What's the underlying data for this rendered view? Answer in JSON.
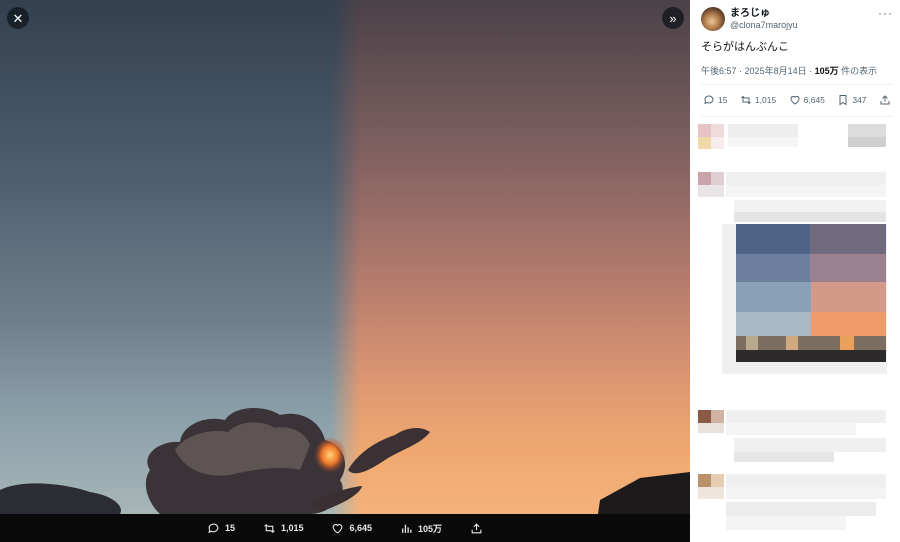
{
  "viewer": {
    "close_icon": "close-icon",
    "expand_icon": "double-chevron-right-icon",
    "stats": {
      "replies": "15",
      "reposts": "1,015",
      "likes": "6,645",
      "views": "105万"
    }
  },
  "post": {
    "display_name": "まろじゅ",
    "handle": "@clona7marojyu",
    "text": "そらがはんぶんこ",
    "time": "午後6:57",
    "date": "2025年8月14日",
    "views_count": "105万",
    "views_label": "件の表示",
    "actions": {
      "replies": "15",
      "reposts": "1,015",
      "likes": "6,645",
      "bookmarks": "347"
    },
    "more_label": "···"
  },
  "colors": {
    "sky_left": "#6e7f8c",
    "sky_right": "#de9872",
    "text_secondary": "#536471"
  }
}
